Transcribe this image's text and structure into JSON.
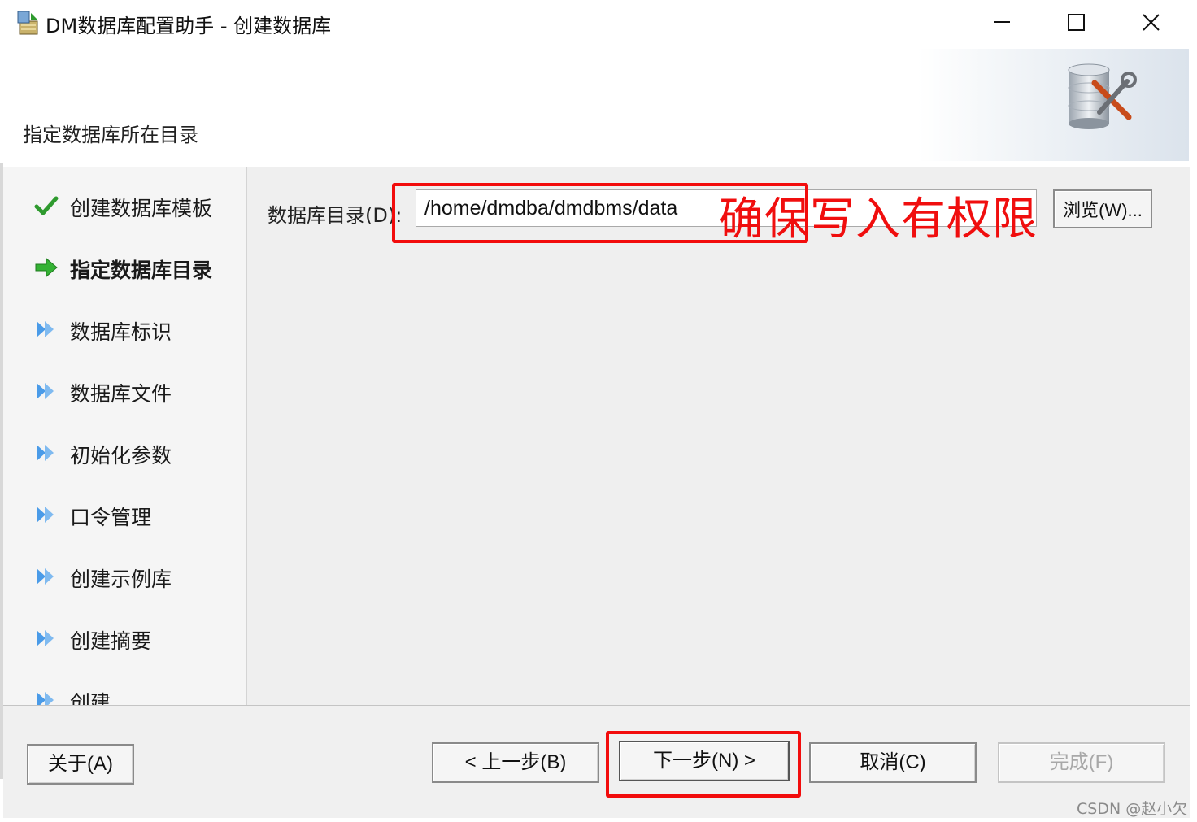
{
  "window": {
    "title": "DM数据库配置助手 - 创建数据库",
    "controls": [
      "minimize-icon",
      "maximize-icon",
      "close-icon"
    ]
  },
  "header": {
    "subtitle": "指定数据库所在目录",
    "art_icon": "database-wrench-icon"
  },
  "steps": [
    {
      "label": "创建数据库模板",
      "status": "completed",
      "icon": "check-icon"
    },
    {
      "label": "指定数据库目录",
      "status": "current",
      "icon": "arrow-right-icon"
    },
    {
      "label": "数据库标识",
      "status": "pending",
      "icon": "double-chevron-icon"
    },
    {
      "label": "数据库文件",
      "status": "pending",
      "icon": "double-chevron-icon"
    },
    {
      "label": "初始化参数",
      "status": "pending",
      "icon": "double-chevron-icon"
    },
    {
      "label": "口令管理",
      "status": "pending",
      "icon": "double-chevron-icon"
    },
    {
      "label": "创建示例库",
      "status": "pending",
      "icon": "double-chevron-icon"
    },
    {
      "label": "创建摘要",
      "status": "pending",
      "icon": "double-chevron-icon"
    },
    {
      "label": "创建",
      "status": "pending",
      "icon": "double-chevron-icon"
    }
  ],
  "form": {
    "dir_label": "数据库目录(D):",
    "dir_value": "/home/dmdba/dmdbms/data",
    "browse_label": "浏览(W)..."
  },
  "annotation": {
    "text": "确保写入有权限",
    "color": "#f20c0c"
  },
  "buttons": {
    "about": "关于(A)",
    "prev": "< 上一步(B)",
    "next": "下一步(N) >",
    "cancel": "取消(C)",
    "finish": "完成(F)"
  },
  "watermark": "CSDN @赵小欠",
  "colors": {
    "accent_green": "#2e9a2e",
    "step_arrow_blue": "#3a8ee6",
    "annotation_red": "#f20c0c"
  }
}
